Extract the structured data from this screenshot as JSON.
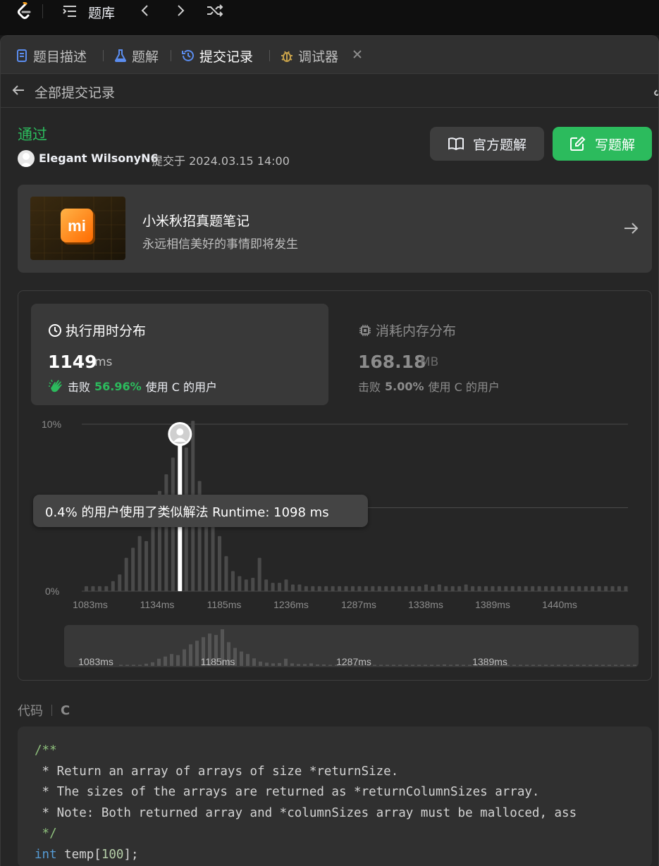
{
  "topbar": {
    "title": "题库"
  },
  "tabs": [
    {
      "label": "题目描述",
      "icon": "description-icon",
      "color": "#5b8def"
    },
    {
      "label": "题解",
      "icon": "flask-icon",
      "color": "#5b8def"
    },
    {
      "label": "提交记录",
      "icon": "history-icon",
      "color": "#5b8def"
    },
    {
      "label": "调试器",
      "icon": "bug-icon",
      "color": "#c8a24a"
    }
  ],
  "back": {
    "label": "全部提交记录"
  },
  "submission": {
    "status": "通过",
    "user": "Elegant WilsonyN6",
    "submitted_at": "提交于 2024.03.15 14:00"
  },
  "actions": {
    "official_label": "官方题解",
    "write_label": "写题解"
  },
  "promo": {
    "title": "小米秋招真题笔记",
    "subtitle": "永远相信美好的事情即将发生",
    "logo_text": "mi"
  },
  "runtime": {
    "heading": "执行用时分布",
    "value": "1149",
    "unit": "ms",
    "beat_prefix": "击败",
    "beat_pct": "56.96%",
    "beat_suffix": "使用 C 的用户"
  },
  "memory": {
    "heading": "消耗内存分布",
    "value": "168.18",
    "unit": "MB",
    "beat_prefix": "击败",
    "beat_pct": "5.00%",
    "beat_suffix": "使用 C 的用户"
  },
  "tooltip": "0.4% 的用户使用了类似解法 Runtime: 1098 ms",
  "code": {
    "label": "代码",
    "lang": "C",
    "lines": [
      "/**",
      " * Return an array of arrays of size *returnSize.",
      " * The sizes of the arrays are returned as *returnColumnSizes array.",
      " * Note: Both returned array and *columnSizes array must be malloced, ass",
      " */",
      "int temp[100];"
    ]
  },
  "chart_data": {
    "type": "bar",
    "ylabel": "",
    "y_ticks": [
      "0%",
      "10%"
    ],
    "ylim": [
      0,
      10
    ],
    "x_ticks": [
      "1083ms",
      "1134ms",
      "1185ms",
      "1236ms",
      "1287ms",
      "1338ms",
      "1389ms",
      "1440ms"
    ],
    "bin_start_ms": 1083,
    "bin_width_ms": 5.1,
    "values": [
      0.3,
      0.3,
      0.3,
      0.3,
      0.6,
      1.0,
      2.0,
      2.6,
      3.3,
      3.0,
      4.6,
      6.0,
      7.0,
      8.0,
      9.0,
      8.6,
      10.2,
      6.6,
      5.0,
      4.0,
      3.3,
      2.1,
      1.2,
      0.9,
      0.7,
      0.8,
      2.0,
      0.7,
      0.5,
      0.5,
      0.7,
      0.4,
      0.4,
      0.3,
      0.3,
      0.3,
      0.3,
      0.3,
      0.3,
      0.3,
      0.3,
      0.3,
      0.3,
      0.3,
      0.3,
      0.3,
      0.3,
      0.3,
      0.3,
      0.3,
      0.3,
      0.4,
      0.3,
      0.4,
      0.3,
      0.3,
      0.3,
      0.4,
      0.3,
      0.3,
      0.3,
      0.3,
      0.3,
      0.3,
      0.3,
      0.3,
      0.3,
      0.3,
      0.3,
      0.3,
      0.3,
      0.3,
      0.3,
      0.3,
      0.3,
      0.3,
      0.3,
      0.3,
      0.3,
      0.3,
      0.3,
      0.3
    ],
    "highlight_bar_index": 14,
    "overview_x_ticks": [
      "1083ms",
      "1185ms",
      "1287ms",
      "1389ms"
    ]
  }
}
